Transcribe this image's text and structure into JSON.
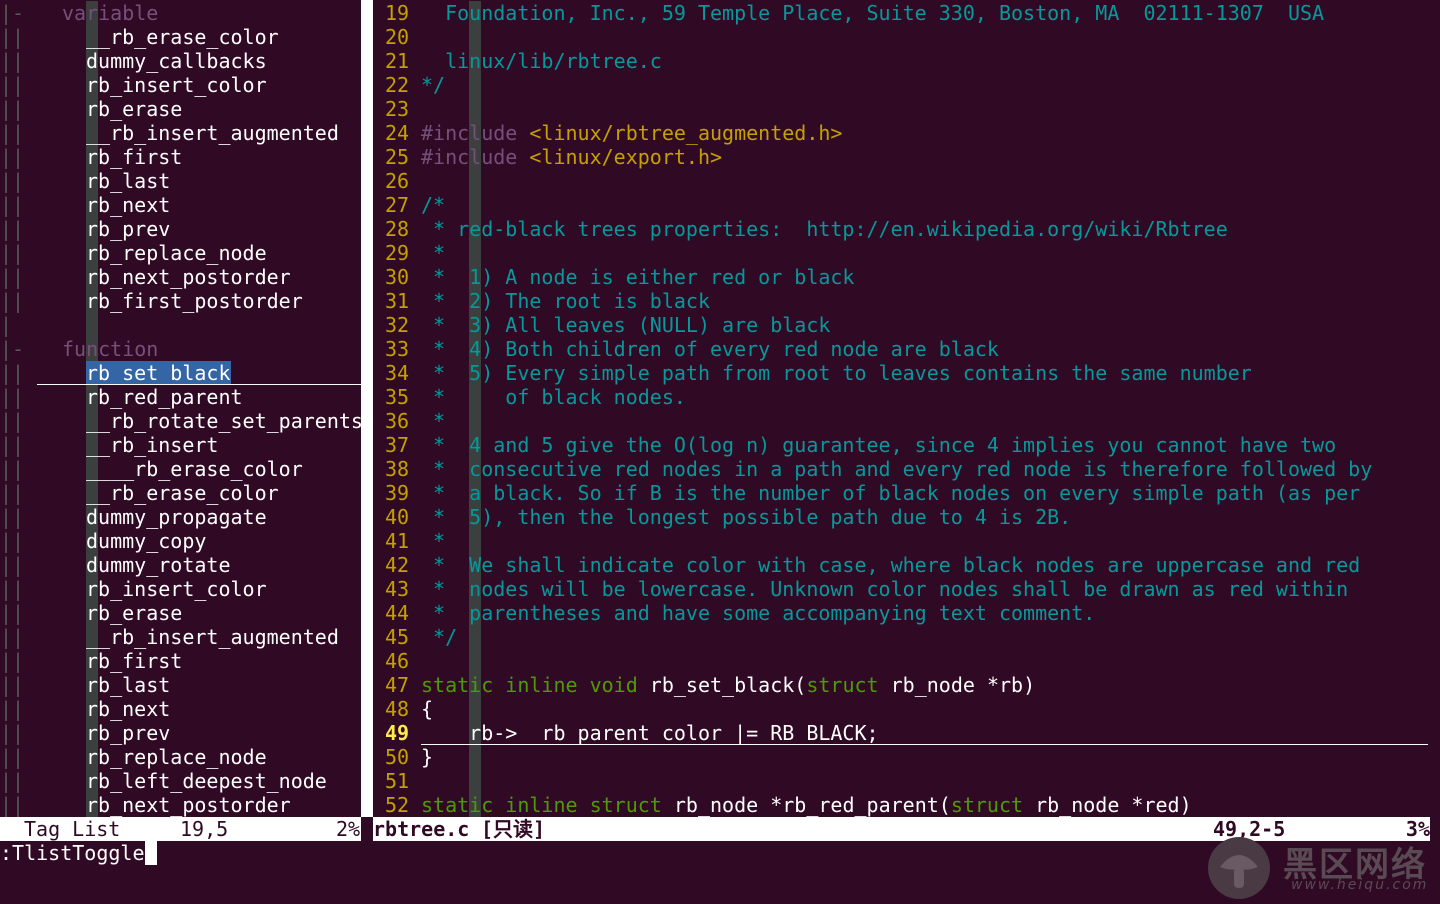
{
  "taglist": {
    "lines": [
      {
        "fold": "|-",
        "group": "variable"
      },
      {
        "fold": "||",
        "tag": "__rb_erase_color"
      },
      {
        "fold": "||",
        "tag": "dummy_callbacks"
      },
      {
        "fold": "||",
        "tag": "rb_insert_color"
      },
      {
        "fold": "||",
        "tag": "rb_erase"
      },
      {
        "fold": "||",
        "tag": "__rb_insert_augmented"
      },
      {
        "fold": "||",
        "tag": "rb_first"
      },
      {
        "fold": "||",
        "tag": "rb_last"
      },
      {
        "fold": "||",
        "tag": "rb_next"
      },
      {
        "fold": "||",
        "tag": "rb_prev"
      },
      {
        "fold": "||",
        "tag": "rb_replace_node"
      },
      {
        "fold": "||",
        "tag": "rb_next_postorder"
      },
      {
        "fold": "||",
        "tag": "rb_first_postorder"
      },
      {
        "fold": "|"
      },
      {
        "fold": "|-",
        "group": "function"
      },
      {
        "fold": "||",
        "tag": "rb_set_black",
        "current": true
      },
      {
        "fold": "||",
        "tag": "rb_red_parent"
      },
      {
        "fold": "||",
        "tag": "__rb_rotate_set_parents"
      },
      {
        "fold": "||",
        "tag": "__rb_insert"
      },
      {
        "fold": "||",
        "tag": "____rb_erase_color"
      },
      {
        "fold": "||",
        "tag": "__rb_erase_color"
      },
      {
        "fold": "||",
        "tag": "dummy_propagate"
      },
      {
        "fold": "||",
        "tag": "dummy_copy"
      },
      {
        "fold": "||",
        "tag": "dummy_rotate"
      },
      {
        "fold": "||",
        "tag": "rb_insert_color"
      },
      {
        "fold": "||",
        "tag": "rb_erase"
      },
      {
        "fold": "||",
        "tag": "__rb_insert_augmented"
      },
      {
        "fold": "||",
        "tag": "rb_first"
      },
      {
        "fold": "||",
        "tag": "rb_last"
      },
      {
        "fold": "||",
        "tag": "rb_next"
      },
      {
        "fold": "||",
        "tag": "rb_prev"
      },
      {
        "fold": "||",
        "tag": "rb_replace_node"
      },
      {
        "fold": "||",
        "tag": "rb_left_deepest_node"
      },
      {
        "fold": "||",
        "tag": "rb_next_postorder"
      }
    ],
    "status": {
      "name": "Tag List",
      "position": "19,5",
      "percent": "2%"
    }
  },
  "editor": {
    "current_line": "49",
    "lines": [
      {
        "n": "19",
        "parts": [
          [
            "cm",
            "  Foundation, Inc., 59 Temple Place, Suite 330, Boston, MA  02111-1307  USA"
          ]
        ]
      },
      {
        "n": "20",
        "parts": []
      },
      {
        "n": "21",
        "parts": [
          [
            "cm",
            "  linux/lib/rbtree.c"
          ]
        ]
      },
      {
        "n": "22",
        "parts": [
          [
            "cm",
            "*/"
          ]
        ]
      },
      {
        "n": "23",
        "parts": []
      },
      {
        "n": "24",
        "parts": [
          [
            "pp",
            "#include "
          ],
          [
            "inc",
            "<linux/rbtree_augmented.h>"
          ]
        ]
      },
      {
        "n": "25",
        "parts": [
          [
            "pp",
            "#include "
          ],
          [
            "inc",
            "<linux/export.h>"
          ]
        ]
      },
      {
        "n": "26",
        "parts": []
      },
      {
        "n": "27",
        "parts": [
          [
            "cm",
            "/*"
          ]
        ]
      },
      {
        "n": "28",
        "parts": [
          [
            "cm",
            " * red-black trees properties:  http://en.wikipedia.org/wiki/Rbtree"
          ]
        ]
      },
      {
        "n": "29",
        "parts": [
          [
            "cm",
            " *"
          ]
        ]
      },
      {
        "n": "30",
        "parts": [
          [
            "cm",
            " *  1) A node is either red or black"
          ]
        ]
      },
      {
        "n": "31",
        "parts": [
          [
            "cm",
            " *  2) The root is black"
          ]
        ]
      },
      {
        "n": "32",
        "parts": [
          [
            "cm",
            " *  3) All leaves (NULL) are black"
          ]
        ]
      },
      {
        "n": "33",
        "parts": [
          [
            "cm",
            " *  4) Both children of every red node are black"
          ]
        ]
      },
      {
        "n": "34",
        "parts": [
          [
            "cm",
            " *  5) Every simple path from root to leaves contains the same number"
          ]
        ]
      },
      {
        "n": "35",
        "parts": [
          [
            "cm",
            " *     of black nodes."
          ]
        ]
      },
      {
        "n": "36",
        "parts": [
          [
            "cm",
            " *"
          ]
        ]
      },
      {
        "n": "37",
        "parts": [
          [
            "cm",
            " *  4 and 5 give the O(log n) guarantee, since 4 implies you cannot have two"
          ]
        ]
      },
      {
        "n": "38",
        "parts": [
          [
            "cm",
            " *  consecutive red nodes in a path and every red node is therefore followed by"
          ]
        ]
      },
      {
        "n": "39",
        "parts": [
          [
            "cm",
            " *  a black. So if B is the number of black nodes on every simple path (as per"
          ]
        ]
      },
      {
        "n": "40",
        "parts": [
          [
            "cm",
            " *  5), then the longest possible path due to 4 is 2B."
          ]
        ]
      },
      {
        "n": "41",
        "parts": [
          [
            "cm",
            " *"
          ]
        ]
      },
      {
        "n": "42",
        "parts": [
          [
            "cm",
            " *  We shall indicate color with case, where black nodes are uppercase and red"
          ]
        ]
      },
      {
        "n": "43",
        "parts": [
          [
            "cm",
            " *  nodes will be lowercase. Unknown color nodes shall be drawn as red within"
          ]
        ]
      },
      {
        "n": "44",
        "parts": [
          [
            "cm",
            " *  parentheses and have some accompanying text comment."
          ]
        ]
      },
      {
        "n": "45",
        "parts": [
          [
            "cm",
            " */"
          ]
        ]
      },
      {
        "n": "46",
        "parts": []
      },
      {
        "n": "47",
        "parts": [
          [
            "kw",
            "static inline void"
          ],
          [
            "tx",
            " rb_set_black("
          ],
          [
            "kw",
            "struct"
          ],
          [
            "tx",
            " rb_node *rb)"
          ]
        ]
      },
      {
        "n": "48",
        "parts": [
          [
            "tx",
            "{"
          ]
        ]
      },
      {
        "n": "49",
        "parts": [
          [
            "tx",
            "    rb->__rb_parent_color |= RB_BLACK;"
          ]
        ]
      },
      {
        "n": "50",
        "parts": [
          [
            "tx",
            "}"
          ]
        ]
      },
      {
        "n": "51",
        "parts": []
      },
      {
        "n": "52",
        "parts": [
          [
            "kw",
            "static inline struct"
          ],
          [
            "tx",
            " rb_node *rb_red_parent("
          ],
          [
            "kw",
            "struct"
          ],
          [
            "tx",
            " rb_node *red)"
          ]
        ]
      }
    ],
    "status": {
      "filename": "rbtree.c",
      "flag": "[只读]",
      "position": "49,2-5",
      "percent": "3%"
    }
  },
  "cmdline": ":TlistToggle",
  "watermark": {
    "text": "黑区网络",
    "url": "www.heiqu.com",
    "icon": "mushroom-logo-icon"
  },
  "colors": {
    "background": "#300a24",
    "comment": "#06989a",
    "keyword": "#4e9a06",
    "linenr": "#c4a000",
    "preproc": "#75507b",
    "selection": "#3465a4"
  }
}
